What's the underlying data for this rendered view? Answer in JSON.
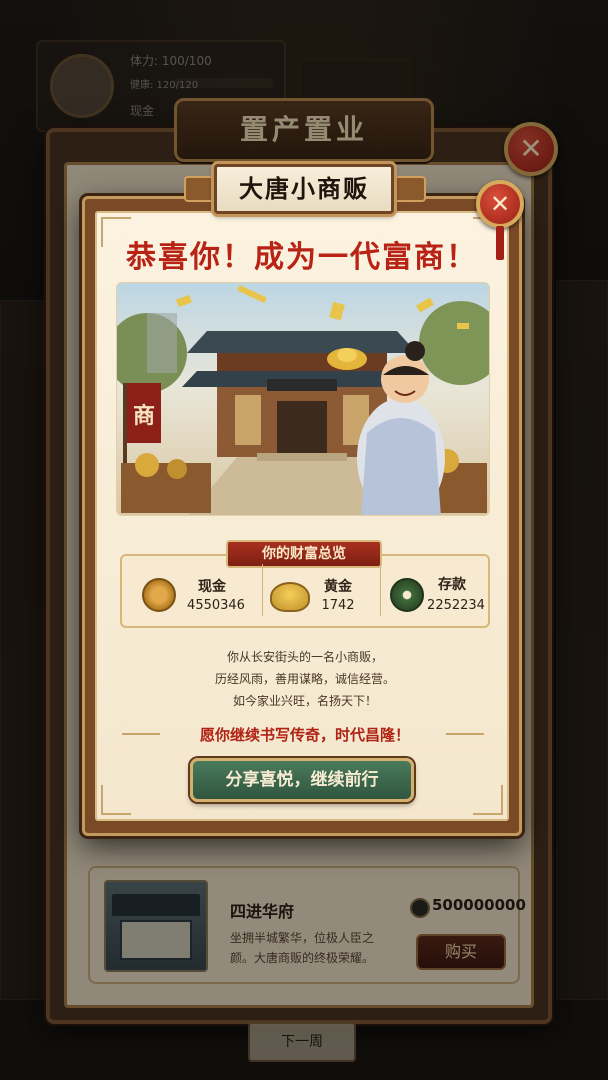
{
  "hud": {
    "stamina": "体力: 100/100",
    "health": "健康: 120/120",
    "cash_label": "现金"
  },
  "outer_window": {
    "title": "置产置业",
    "close_glyph": "✕"
  },
  "modal": {
    "title": "大唐小商贩",
    "close_glyph": "✕",
    "congrats": "恭喜你！成为一代富商！",
    "sign_char": "商",
    "wealth": {
      "heading": "你的财富总览",
      "items": [
        {
          "label": "现金",
          "value": "4550346",
          "icon": "copper-coin-icon"
        },
        {
          "label": "黄金",
          "value": "1742",
          "icon": "gold-ingot-icon"
        },
        {
          "label": "存款",
          "value": "2252234",
          "icon": "jade-coin-icon"
        }
      ]
    },
    "story": [
      "你从长安街头的一名小商贩，",
      "历经风雨，善用谋略，诚信经营。",
      "如今家业兴旺，名扬天下！"
    ],
    "wish": "愿你继续书写传奇，时代昌隆！",
    "share_button": "分享喜悦，继续前行"
  },
  "estate": {
    "name": "四进华府",
    "description": "坐拥半城繁华，位极人臣之颜。大唐商贩的终极荣耀。",
    "price": "500000000",
    "buy_label": "购买"
  },
  "footer": {
    "next_week": "下一周"
  },
  "colors": {
    "accent_red": "#b82316",
    "share_green": "#3e6a4e",
    "frame_brown": "#7a4a26",
    "gold": "#d4b06f"
  }
}
